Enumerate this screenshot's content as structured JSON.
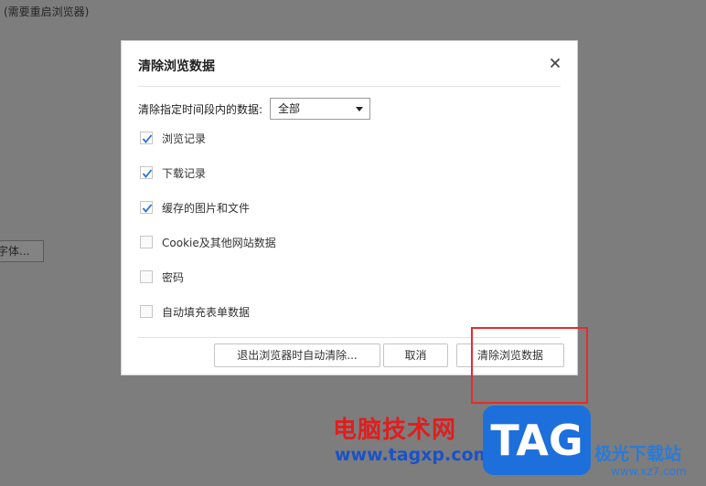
{
  "background": {
    "note": "(需要重启浏览器)",
    "button_label": "字体..."
  },
  "dialog": {
    "title": "清除浏览数据",
    "close_icon": "close-icon",
    "time_range": {
      "label": "清除指定时间段内的数据:",
      "selected": "全部"
    },
    "options": [
      {
        "label": "浏览记录",
        "checked": true
      },
      {
        "label": "下载记录",
        "checked": true
      },
      {
        "label": "缓存的图片和文件",
        "checked": true
      },
      {
        "label": "Cookie及其他网站数据",
        "checked": false
      },
      {
        "label": "密码",
        "checked": false
      },
      {
        "label": "自动填充表单数据",
        "checked": false
      }
    ],
    "buttons": {
      "auto_clear": "退出浏览器时自动清除...",
      "cancel": "取消",
      "clear": "清除浏览数据"
    }
  },
  "watermark": {
    "site_name": "电脑技术网",
    "url": "www.tagxp.com",
    "logo_text": "TAG",
    "side_name": "极光下载站",
    "side_url": "www.xz7.com"
  },
  "colors": {
    "check": "#2a6fd6",
    "highlight": "#e62b2b"
  }
}
